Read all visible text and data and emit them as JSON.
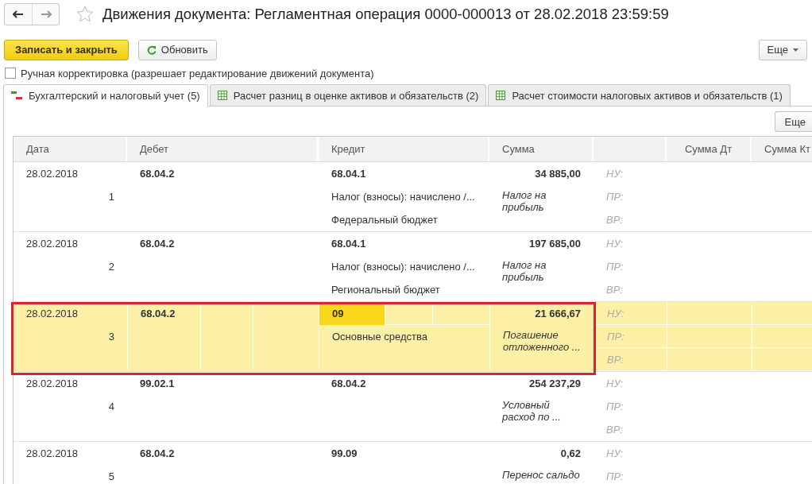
{
  "window": {
    "title": "Движения документа: Регламентная операция 0000-000013 от 28.02.2018 23:59:59",
    "favorite": false
  },
  "toolbar": {
    "buttons": [
      {
        "label": "Записать и закрыть",
        "kind": "primary"
      },
      {
        "label": "Обновить",
        "kind": "refresh"
      }
    ],
    "more": "Еще"
  },
  "manual_edit": {
    "label": "Ручная корректировка (разрешает редактирование движений документа)",
    "checked": false
  },
  "tabs": [
    {
      "label": "Бухгалтерский и налоговый учет (5)",
      "kind": "ledger",
      "selected": true
    },
    {
      "label": "Расчет разниц в оценке активов и обязательств (2)",
      "kind": "table",
      "selected": false
    },
    {
      "label": "Расчет стоимости налоговых активов и обязательств (1)",
      "kind": "table",
      "selected": false
    }
  ],
  "table_more": "Еще",
  "table": {
    "columns": [
      {
        "label": "Дата"
      },
      {
        "label": "Дебет"
      },
      {
        "label": "Кредит"
      },
      {
        "label": "Сумма"
      },
      {},
      {
        "label": "Сумма Дт"
      },
      {
        "label": "Сумма Кт"
      }
    ],
    "rows": [
      {
        "date": "28.02.2018",
        "number": "1",
        "debit": "68.04.2",
        "credit": "68.04.1",
        "credit_lines": [
          "Налог (взносы): начислено /...",
          "Федеральный бюджет"
        ],
        "amount": "34 885,00",
        "note": "Налог на прибыль",
        "tax_labels": [
          "НУ:",
          "ПР:",
          "ВР:"
        ],
        "selected": false,
        "credit_focused": false
      },
      {
        "date": "28.02.2018",
        "number": "2",
        "debit": "68.04.2",
        "credit": "68.04.1",
        "credit_lines": [
          "Налог (взносы): начислено /...",
          "Региональный бюджет"
        ],
        "amount": "197 685,00",
        "note": "Налог на прибыль",
        "tax_labels": [
          "НУ:",
          "ПР:",
          "ВР:"
        ],
        "selected": false,
        "credit_focused": false
      },
      {
        "date": "28.02.2018",
        "number": "3",
        "debit": "68.04.2",
        "credit": "09",
        "credit_lines": [
          "Основные средства"
        ],
        "amount": "21 666,67",
        "note": "Погашение отложенного ...",
        "tax_labels": [
          "НУ:",
          "ПР:",
          "ВР:"
        ],
        "selected": true,
        "credit_focused": true
      },
      {
        "date": "28.02.2018",
        "number": "4",
        "debit": "99.02.1",
        "credit": "68.04.2",
        "credit_lines": [],
        "amount": "254 237,29",
        "note": "Условный расход по ...",
        "tax_labels": [
          "НУ:",
          "ПР:",
          "ВР:"
        ],
        "selected": false,
        "credit_focused": false
      },
      {
        "date": "28.02.2018",
        "number": "5",
        "debit": "68.04.2",
        "credit": "99.09",
        "credit_lines": [],
        "amount": "0,62",
        "note": "Перенос сальдо",
        "tax_labels": [
          "НУ:",
          "ПР:"
        ],
        "selected": false,
        "credit_focused": false
      }
    ]
  }
}
